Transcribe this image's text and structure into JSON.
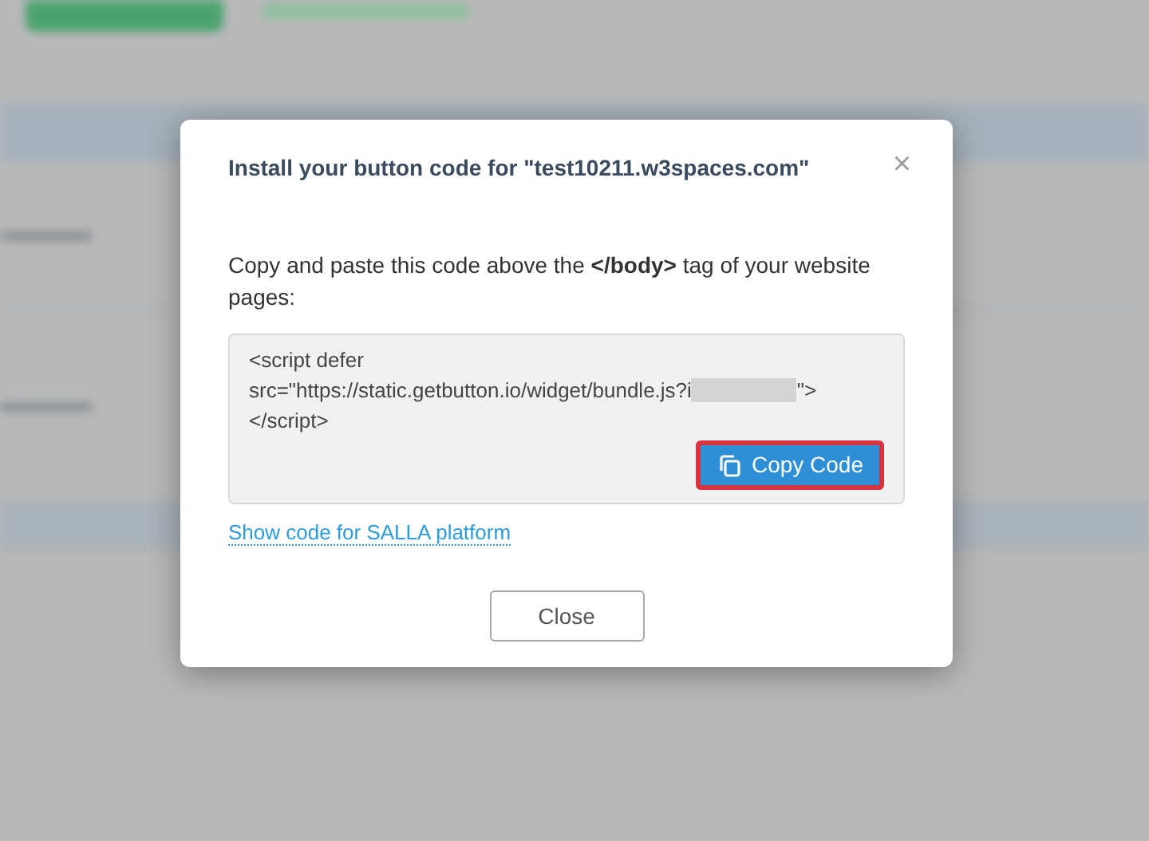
{
  "dialog": {
    "title": "Install your button code for \"test10211.w3spaces.com\"",
    "close_icon": "×",
    "instruction": "Copy and paste this code above the **</body>** tag of your website pages:",
    "code_lines": [
      {
        "kind": "text",
        "text": "<script defer"
      },
      {
        "kind": "redacted",
        "before": "src=\"https://static.getbutton.io/widget/bundle.js?i",
        "after": "\">"
      },
      {
        "kind": "text",
        "text": "</script>"
      }
    ],
    "copy_button": {
      "label": "Copy Code",
      "highlighted": true
    },
    "platform_link": "Show code for SALLA platform",
    "close_button": "Close"
  }
}
